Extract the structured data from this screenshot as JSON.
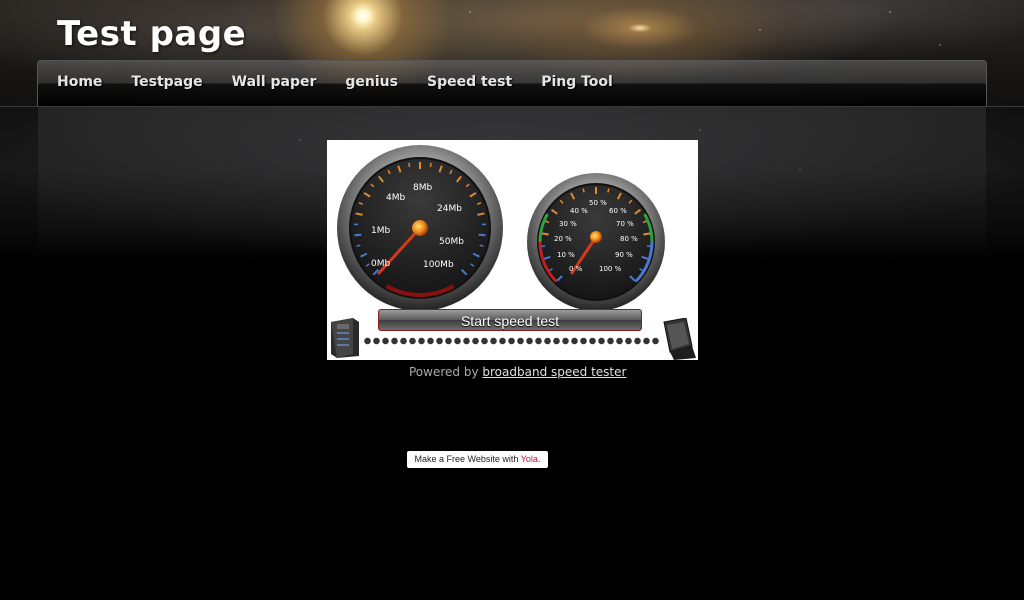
{
  "site": {
    "title": "Test page"
  },
  "nav": {
    "items": [
      {
        "label": "Home",
        "name": "nav-home"
      },
      {
        "label": "Testpage",
        "name": "nav-testpage"
      },
      {
        "label": "Wall paper",
        "name": "nav-wall-paper"
      },
      {
        "label": "genius",
        "name": "nav-genius"
      },
      {
        "label": "Speed test",
        "name": "nav-speed-test"
      },
      {
        "label": "Ping Tool",
        "name": "nav-ping-tool"
      }
    ]
  },
  "speed_test": {
    "speed_gauge_labels": [
      "0Mb",
      "1Mb",
      "4Mb",
      "8Mb",
      "24Mb",
      "50Mb",
      "100Mb"
    ],
    "percent_gauge_labels": [
      "0 %",
      "10 %",
      "20 %",
      "30 %",
      "40 %",
      "50 %",
      "60 %",
      "70 %",
      "80 %",
      "90 %",
      "100 %"
    ],
    "start_button_label": "Start speed test"
  },
  "footer": {
    "powered_prefix": "Powered by",
    "powered_link": "broadband speed tester",
    "yola_text": "Make a Free Website with",
    "yola_brand": "Yola",
    "yola_suffix": "."
  },
  "colors": {
    "gauge_needle": "#d43a1a",
    "gauge_face": "#1d1d1d",
    "yola_brand": "#c0103a"
  }
}
